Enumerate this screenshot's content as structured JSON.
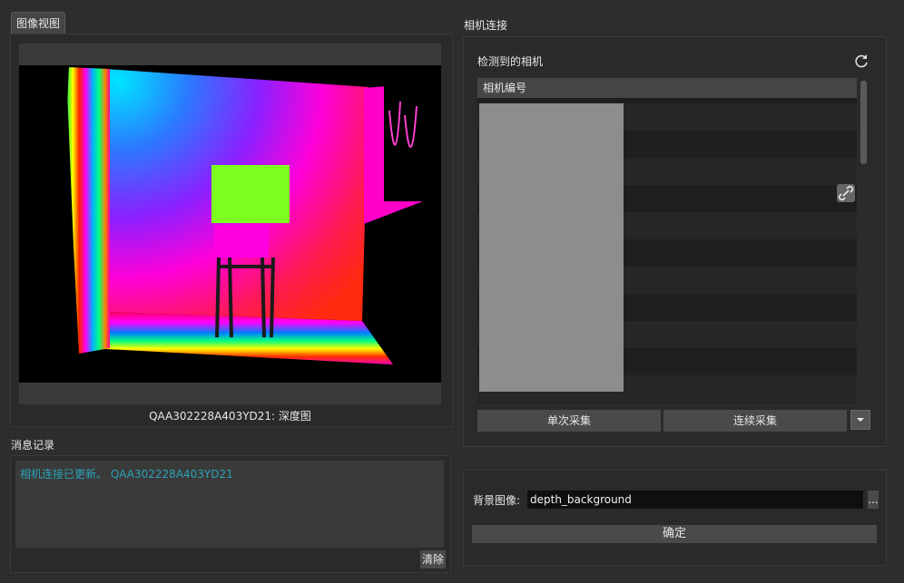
{
  "image_view": {
    "tab_label": "图像视图",
    "caption": "QAA302228A403YD21: 深度图"
  },
  "log": {
    "title": "消息记录",
    "message": "相机连接已更新。 QAA302228A403YD21",
    "clear_label": "清除"
  },
  "camera": {
    "title": "相机连接",
    "detected_label": "检测到的相机",
    "column_header": "相机编号",
    "single_capture": "单次采集",
    "continuous_capture": "连续采集",
    "dropdown_icon": "chevron-down-icon",
    "refresh_icon": "refresh-icon",
    "link_icon": "link-icon"
  },
  "background": {
    "label": "背景图像:",
    "value": "depth_background",
    "browse_label": "...",
    "confirm_label": "确定"
  }
}
